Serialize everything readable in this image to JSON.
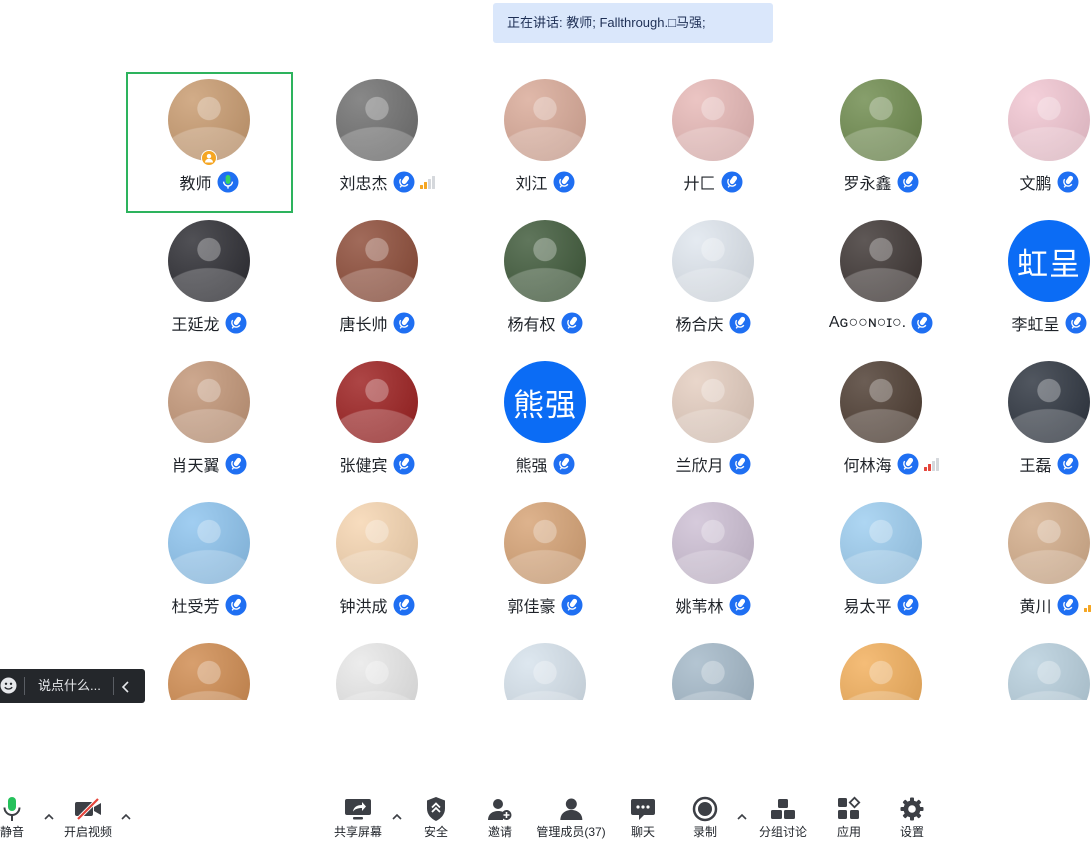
{
  "banner": {
    "speaking": "正在讲话: 教师; Fallthrough.□马强;"
  },
  "colors": {
    "accent": "#1f6ff2",
    "active_speaker_border": "#2db35d",
    "host_badge": "#f5a623",
    "mic_green": "#25c15b",
    "video_off_red": "#e5453b",
    "text_avatar": "#0b6cf5"
  },
  "participants": [
    {
      "name": "教师",
      "avatar": {
        "kind": "photo",
        "color": "#c89a6e"
      },
      "mic_icon": "mic-speaking-icon",
      "host": true,
      "active_speaker": true
    },
    {
      "name": "刘忠杰",
      "avatar": {
        "kind": "photo",
        "color": "#6e6e6e"
      },
      "mic_icon": "mic-icon",
      "signal": {
        "level": 2,
        "color": "#f5a623"
      }
    },
    {
      "name": "刘江",
      "avatar": {
        "kind": "photo",
        "color": "#d9a997"
      },
      "mic_icon": "mic-icon"
    },
    {
      "name": "廾匚",
      "avatar": {
        "kind": "photo",
        "color": "#e7b8b6"
      },
      "mic_icon": "mic-icon"
    },
    {
      "name": "罗永鑫",
      "avatar": {
        "kind": "photo",
        "color": "#6d8a4c"
      },
      "mic_icon": "mic-icon"
    },
    {
      "name": "文鹏",
      "avatar": {
        "kind": "photo",
        "color": "#f2c6d2"
      },
      "mic_icon": "mic-icon"
    },
    {
      "name": "王延龙",
      "avatar": {
        "kind": "photo",
        "color": "#2a2a30"
      },
      "mic_icon": "mic-icon"
    },
    {
      "name": "唐长帅",
      "avatar": {
        "kind": "photo",
        "color": "#8c4a36"
      },
      "mic_icon": "mic-icon"
    },
    {
      "name": "杨有权",
      "avatar": {
        "kind": "photo",
        "color": "#3d5838"
      },
      "mic_icon": "mic-icon"
    },
    {
      "name": "杨合庆",
      "avatar": {
        "kind": "photo",
        "color": "#dfe6ee"
      },
      "mic_icon": "mic-icon"
    },
    {
      "name": "Aɢ○○ɴ○ɪ○.",
      "avatar": {
        "kind": "photo",
        "color": "#3b3331"
      },
      "mic_icon": "mic-icon"
    },
    {
      "name": "李虹呈",
      "avatar": {
        "kind": "text",
        "text": "虹呈",
        "color": "#0b6cf5"
      },
      "mic_icon": "mic-icon"
    },
    {
      "name": "肖天翼",
      "avatar": {
        "kind": "photo",
        "color": "#c29576"
      },
      "mic_icon": "mic-icon"
    },
    {
      "name": "张健宾",
      "avatar": {
        "kind": "photo",
        "color": "#9b1d1d"
      },
      "mic_icon": "mic-icon"
    },
    {
      "name": "熊强",
      "avatar": {
        "kind": "text",
        "text": "熊强",
        "color": "#0b6cf5"
      },
      "mic_icon": "mic-icon"
    },
    {
      "name": "兰欣月",
      "avatar": {
        "kind": "photo",
        "color": "#e4cdbf"
      },
      "mic_icon": "mic-icon"
    },
    {
      "name": "何林海",
      "avatar": {
        "kind": "photo",
        "color": "#4b3a2f"
      },
      "mic_icon": "mic-icon",
      "signal": {
        "level": 2,
        "color": "#e5453b"
      }
    },
    {
      "name": "王磊",
      "avatar": {
        "kind": "photo",
        "color": "#2b323d"
      },
      "mic_icon": "mic-icon"
    },
    {
      "name": "杜受芳",
      "avatar": {
        "kind": "photo",
        "color": "#8cc3ee"
      },
      "mic_icon": "mic-icon"
    },
    {
      "name": "钟洪成",
      "avatar": {
        "kind": "photo",
        "color": "#f6d5b0"
      },
      "mic_icon": "mic-icon"
    },
    {
      "name": "郭佳豪",
      "avatar": {
        "kind": "photo",
        "color": "#d6a274"
      },
      "mic_icon": "mic-icon"
    },
    {
      "name": "姚苇林",
      "avatar": {
        "kind": "photo",
        "color": "#cdbfd4"
      },
      "mic_icon": "mic-icon"
    },
    {
      "name": "易太平",
      "avatar": {
        "kind": "photo",
        "color": "#9ccdf0"
      },
      "mic_icon": "mic-icon"
    },
    {
      "name": "黄川",
      "avatar": {
        "kind": "photo",
        "color": "#d4ad8a"
      },
      "mic_icon": "mic-icon",
      "signal": {
        "level": 2,
        "color": "#f5a623"
      }
    },
    {
      "avatar": {
        "kind": "photo",
        "color": "#cf8a4e"
      }
    },
    {
      "avatar": {
        "kind": "photo",
        "color": "#e8e8e8"
      }
    },
    {
      "avatar": {
        "kind": "photo",
        "color": "#d6e2ec"
      }
    },
    {
      "avatar": {
        "kind": "photo",
        "color": "#a3b8c8"
      }
    },
    {
      "avatar": {
        "kind": "photo",
        "color": "#f2ae5a"
      }
    },
    {
      "avatar": {
        "kind": "photo",
        "color": "#b7cfdd"
      }
    }
  ],
  "chat": {
    "placeholder": "说点什么...",
    "emoji_icon": "smiley-icon",
    "collapse_icon": "chevron-left-icon"
  },
  "toolbar": {
    "mute": {
      "label": "静音",
      "icon": "mic-icon"
    },
    "video": {
      "label": "开启视频",
      "icon": "video-off-icon"
    },
    "share_screen": {
      "label": "共享屏幕",
      "icon": "share-screen-icon"
    },
    "security": {
      "label": "安全",
      "icon": "shield-icon"
    },
    "invite": {
      "label": "邀请",
      "icon": "invite-user-icon"
    },
    "members": {
      "label": "管理成员(37)",
      "icon": "members-icon"
    },
    "chat": {
      "label": "聊天",
      "icon": "chat-bubble-icon"
    },
    "record": {
      "label": "录制",
      "icon": "record-icon"
    },
    "breakout": {
      "label": "分组讨论",
      "icon": "breakout-rooms-icon"
    },
    "apps": {
      "label": "应用",
      "icon": "apps-icon"
    },
    "settings": {
      "label": "设置",
      "icon": "gear-icon"
    }
  }
}
